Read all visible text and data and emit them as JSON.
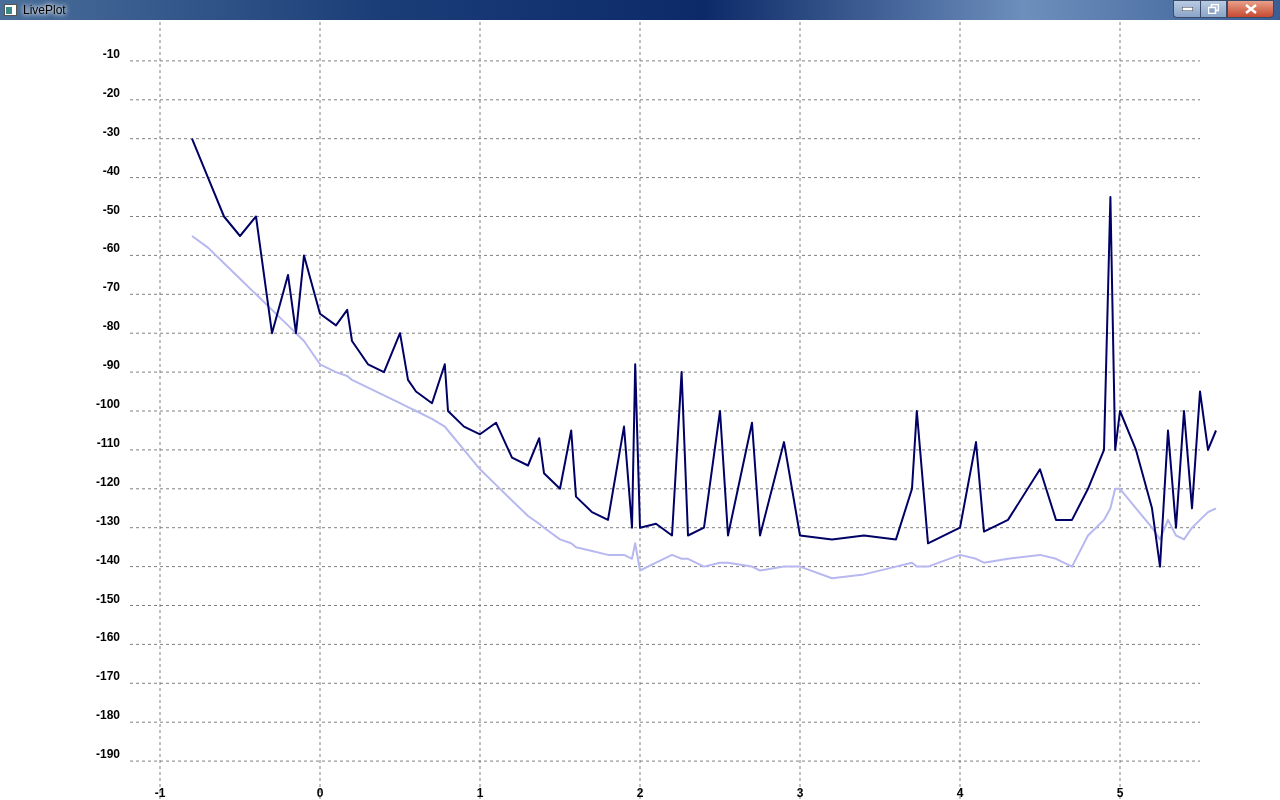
{
  "window": {
    "title": "LivePlot"
  },
  "plot": {
    "chart_data": {
      "type": "line",
      "x": [
        -0.8,
        -0.7,
        -0.6,
        -0.5,
        -0.4,
        -0.3,
        -0.2,
        -0.15,
        -0.1,
        0,
        0.1,
        0.17,
        0.2,
        0.3,
        0.4,
        0.5,
        0.55,
        0.6,
        0.7,
        0.78,
        0.8,
        0.9,
        1.0,
        1.1,
        1.2,
        1.3,
        1.37,
        1.4,
        1.5,
        1.57,
        1.6,
        1.7,
        1.8,
        1.9,
        1.95,
        1.97,
        2.0,
        2.1,
        2.2,
        2.26,
        2.3,
        2.4,
        2.5,
        2.55,
        2.7,
        2.75,
        2.9,
        3.0,
        3.2,
        3.4,
        3.6,
        3.7,
        3.73,
        3.8,
        4.0,
        4.1,
        4.15,
        4.3,
        4.5,
        4.6,
        4.7,
        4.8,
        4.9,
        4.94,
        4.97,
        5.0,
        5.1,
        5.2,
        5.25,
        5.3,
        5.35,
        5.4,
        5.45,
        5.5,
        5.55,
        5.6
      ],
      "series": [
        {
          "color": "#000066",
          "values": [
            -30,
            -40,
            -50,
            -55,
            -50,
            -80,
            -65,
            -80,
            -60,
            -75,
            -78,
            -74,
            -82,
            -88,
            -90,
            -80,
            -92,
            -95,
            -98,
            -88,
            -100,
            -104,
            -106,
            -103,
            -112,
            -114,
            -107,
            -116,
            -120,
            -105,
            -122,
            -126,
            -128,
            -104,
            -130,
            -88,
            -130,
            -129,
            -132,
            -90,
            -132,
            -130,
            -100,
            -132,
            -103,
            -132,
            -108,
            -132,
            -133,
            -132,
            -133,
            -120,
            -100,
            -134,
            -130,
            -108,
            -131,
            -128,
            -115,
            -128,
            -128,
            -120,
            -110,
            -45,
            -110,
            -100,
            -110,
            -125,
            -140,
            -105,
            -130,
            -100,
            -125,
            -95,
            -110,
            -105
          ]
        },
        {
          "color": "#b8b8f0",
          "values": [
            -55,
            -58,
            -62,
            -66,
            -70,
            -74,
            -78,
            -80,
            -82,
            -88,
            -90,
            -91,
            -92,
            -94,
            -96,
            -98,
            -99,
            -100,
            -102,
            -104,
            -105,
            -110,
            -115,
            -119,
            -123,
            -127,
            -129,
            -130,
            -133,
            -134,
            -135,
            -136,
            -137,
            -137,
            -138,
            -134,
            -141,
            -139,
            -137,
            -138,
            -138,
            -140,
            -139,
            -139,
            -140,
            -141,
            -140,
            -140,
            -143,
            -142,
            -140,
            -139,
            -140,
            -140,
            -137,
            -138,
            -139,
            -138,
            -137,
            -138,
            -140,
            -132,
            -128,
            -125,
            -120,
            -120,
            -125,
            -130,
            -133,
            -128,
            -132,
            -133,
            -130,
            -128,
            -126,
            -125
          ]
        }
      ],
      "xticks": [
        -1,
        0,
        1,
        2,
        3,
        4,
        5
      ],
      "yticks": [
        -10,
        -20,
        -30,
        -40,
        -50,
        -60,
        -70,
        -80,
        -90,
        -100,
        -110,
        -120,
        -130,
        -140,
        -150,
        -160,
        -170,
        -180,
        -190
      ],
      "xlim": [
        -2,
        6
      ],
      "ylim": [
        -200,
        0
      ],
      "grid": true
    }
  }
}
